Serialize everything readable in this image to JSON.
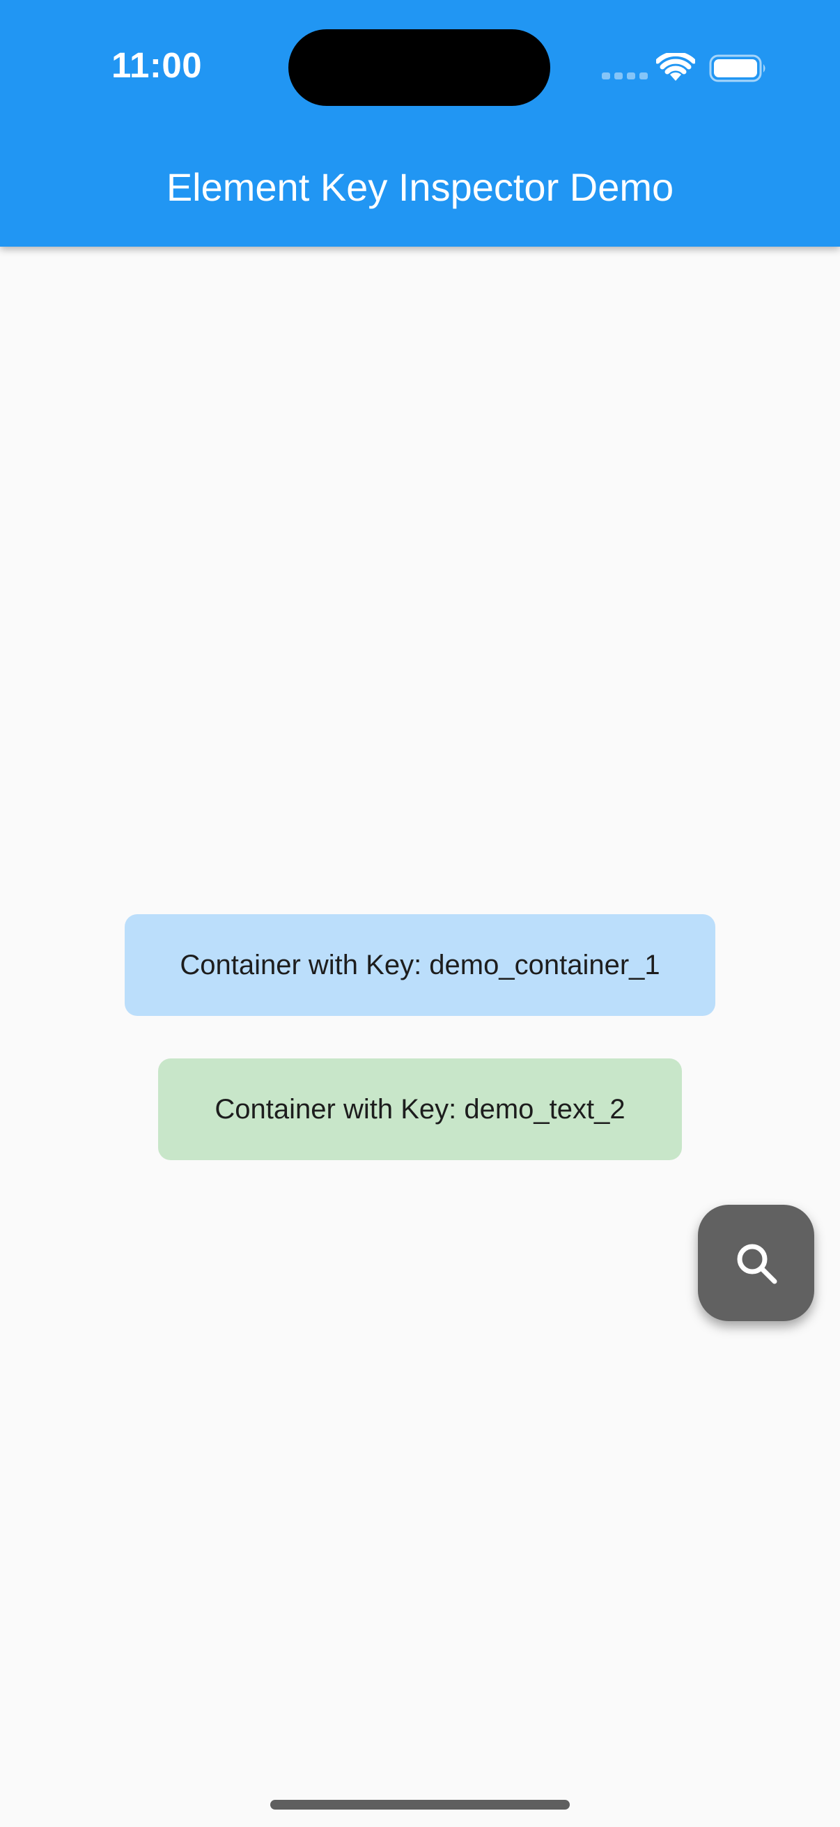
{
  "status_bar": {
    "time": "11:00",
    "icons": [
      "cellular-signal-icon",
      "wifi-icon",
      "battery-icon"
    ]
  },
  "app_bar": {
    "title": "Element Key Inspector Demo",
    "color": "#2196f3"
  },
  "containers": [
    {
      "label": "Container with Key: demo_container_1",
      "color": "#bbdefb"
    },
    {
      "label": "Container with Key: demo_text_2",
      "color": "#c8e6c9"
    }
  ],
  "fab": {
    "icon": "search-icon",
    "color": "#616161"
  }
}
